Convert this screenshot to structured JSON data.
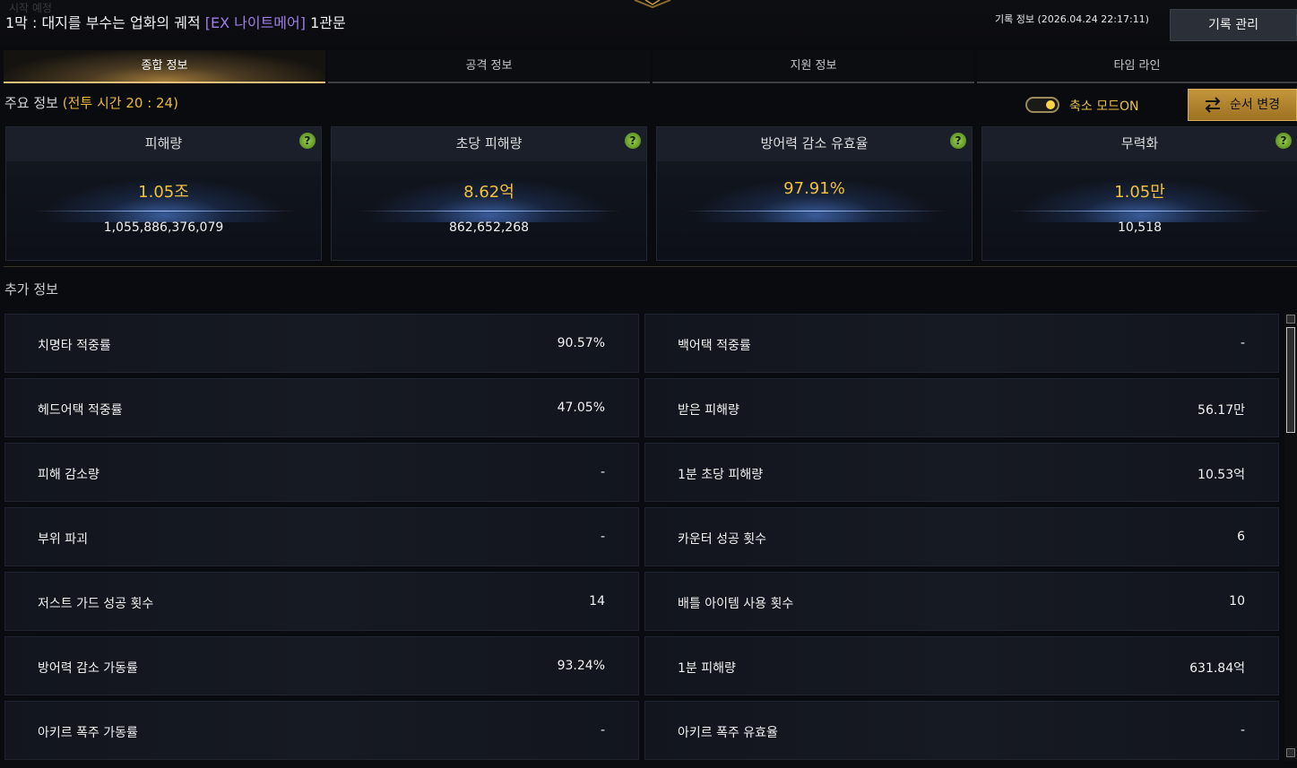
{
  "header": {
    "faded_text": "시작 예정",
    "title_prefix": "1막 : 대지를 부수는 업화의 궤적",
    "title_highlight": "[EX 나이트메어]",
    "title_suffix": "1관문",
    "record_info": "기록 정보 (2026.04.24 22:17:11)",
    "record_manage_label": "기록 관리"
  },
  "tabs": [
    {
      "label": "종합 정보",
      "active": true
    },
    {
      "label": "공격 정보",
      "active": false
    },
    {
      "label": "지원 정보",
      "active": false
    },
    {
      "label": "타임 라인",
      "active": false
    }
  ],
  "main_info": {
    "label": "주요 정보",
    "battle_time": "(전투 시간 20 : 24)",
    "toggle_label": "축소 모드ON",
    "toggle_on": true,
    "order_button": "순서 변경"
  },
  "cards": [
    {
      "title": "피해량",
      "main": "1.05조",
      "detail": "1,055,886,376,079"
    },
    {
      "title": "초당 피해량",
      "main": "8.62억",
      "detail": "862,652,268"
    },
    {
      "title": "방어력 감소 유효율",
      "main": "97.91%",
      "detail": ""
    },
    {
      "title": "무력화",
      "main": "1.05만",
      "detail": "10,518"
    }
  ],
  "extra_info": {
    "label": "추가 정보",
    "left": [
      {
        "label": "치명타 적중률",
        "value": "90.57%"
      },
      {
        "label": "헤드어택 적중률",
        "value": "47.05%"
      },
      {
        "label": "피해 감소량",
        "value": "-"
      },
      {
        "label": "부위 파괴",
        "value": "-"
      },
      {
        "label": "저스트 가드 성공 횟수",
        "value": "14"
      },
      {
        "label": "방어력 감소 가동률",
        "value": "93.24%"
      },
      {
        "label": "아키르 폭주 가동률",
        "value": "-"
      }
    ],
    "right": [
      {
        "label": "백어택 적중률",
        "value": "-"
      },
      {
        "label": "받은 피해량",
        "value": "56.17만"
      },
      {
        "label": "1분 초당 피해량",
        "value": "10.53억"
      },
      {
        "label": "카운터 성공 횟수",
        "value": "6"
      },
      {
        "label": "배틀 아이템 사용 횟수",
        "value": "10"
      },
      {
        "label": "1분 피해량",
        "value": "631.84억"
      },
      {
        "label": "아키르 폭주 유효율",
        "value": "-"
      }
    ]
  },
  "colors": {
    "accent_gold": "#e9b93a",
    "highlight_purple": "#a07de8",
    "background": "#0a0b0e"
  }
}
